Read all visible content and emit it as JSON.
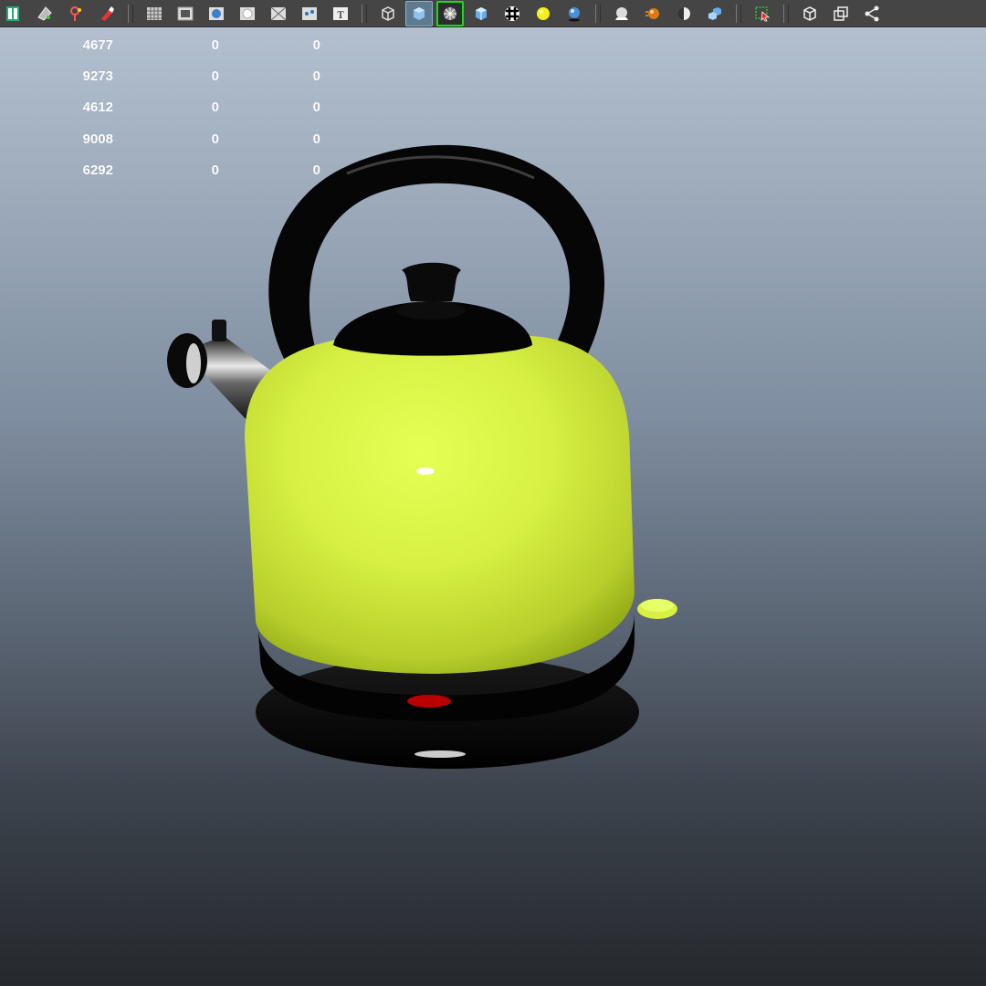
{
  "toolbar": {
    "groups": [
      [
        "script-editor-icon",
        "select-camera-icon",
        "bookmark-icon",
        "paint-tool-icon"
      ],
      [
        "grid-icon",
        "film-gate-icon",
        "resolution-gate-icon",
        "safe-action-icon",
        "field-chart-icon",
        "xray-icon",
        "text-icon"
      ],
      [
        "wireframe-icon",
        "smooth-shade-icon",
        "wireframe-on-shaded-icon",
        "default-material-icon",
        "textured-icon",
        "use-all-lights-icon",
        "shadows-icon"
      ],
      [
        "ambient-occlusion-icon",
        "motion-blur-icon",
        "anti-aliasing-icon",
        "depth-of-field-icon"
      ],
      [
        "isolate-select-icon"
      ],
      [
        "frame-all-icon",
        "frame-selected-icon",
        "share-icon"
      ]
    ],
    "active_tool": "smooth-shade-icon",
    "selected_tool": "wireframe-on-shaded-icon"
  },
  "hud": {
    "rows": [
      [
        "4677",
        "0",
        "0"
      ],
      [
        "9273",
        "0",
        "0"
      ],
      [
        "4612",
        "0",
        "0"
      ],
      [
        "9008",
        "0",
        "0"
      ],
      [
        "6292",
        "0",
        "0"
      ]
    ]
  },
  "scene": {
    "object": "kettle",
    "body_color": "#d7f043",
    "trim_color": "#050505",
    "indicator_color": "#b80000",
    "background_top": "#b7c3d2",
    "background_bottom": "#25282c"
  }
}
